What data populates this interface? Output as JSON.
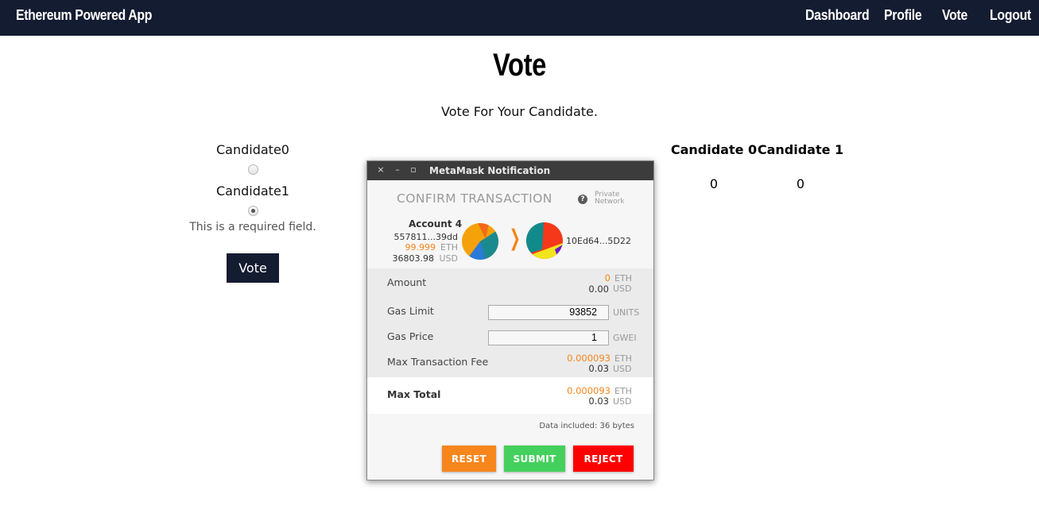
{
  "navbar": {
    "brand": "Ethereum Powered App",
    "links": [
      "Dashboard",
      "Profile",
      "Vote",
      "Logout"
    ]
  },
  "page": {
    "title": "Vote",
    "subtitle": "Vote For Your Candidate.",
    "form": {
      "candidates": [
        {
          "label": "Candidate0",
          "checked": false
        },
        {
          "label": "Candidate1",
          "checked": true
        }
      ],
      "required_text": "This is a required field.",
      "vote_button": "Vote"
    },
    "results": {
      "headers": [
        "Candidate 0",
        "Candidate 1"
      ],
      "values": [
        "0",
        "0"
      ]
    }
  },
  "metamask": {
    "window_title": "MetaMask Notification",
    "window_controls": {
      "close": "×",
      "minimize": "–",
      "maximize": "▫"
    },
    "heading": "CONFIRM TRANSACTION",
    "help_icon": "?",
    "network_line1": "Private",
    "network_line2": "Network",
    "from": {
      "account_name": "Account 4",
      "address": "557811...39dd",
      "eth_balance": "99.999",
      "eth_unit": "ETH",
      "usd_balance": "36803.98",
      "usd_unit": "USD"
    },
    "arrow": "❯",
    "to_address": "10Ed64...5D22",
    "amount": {
      "label": "Amount",
      "eth": "0",
      "eth_unit": "ETH",
      "usd": "0.00",
      "usd_unit": "USD"
    },
    "gas_limit": {
      "label": "Gas Limit",
      "value": "93852",
      "unit": "UNITS"
    },
    "gas_price": {
      "label": "Gas Price",
      "value": "1",
      "unit": "GWEI"
    },
    "max_fee": {
      "label": "Max Transaction Fee",
      "eth": "0.000093",
      "eth_unit": "ETH",
      "usd": "0.03",
      "usd_unit": "USD"
    },
    "max_total": {
      "label": "Max Total",
      "eth": "0.000093",
      "eth_unit": "ETH",
      "usd": "0.03",
      "usd_unit": "USD"
    },
    "data_included": "Data included: 36 bytes",
    "buttons": {
      "reset": "RESET",
      "submit": "SUBMIT",
      "reject": "REJECT"
    },
    "colors": {
      "reset": "#f7861c",
      "submit": "#44d05d",
      "reject": "#ff0000",
      "accent": "#f6851b"
    }
  }
}
